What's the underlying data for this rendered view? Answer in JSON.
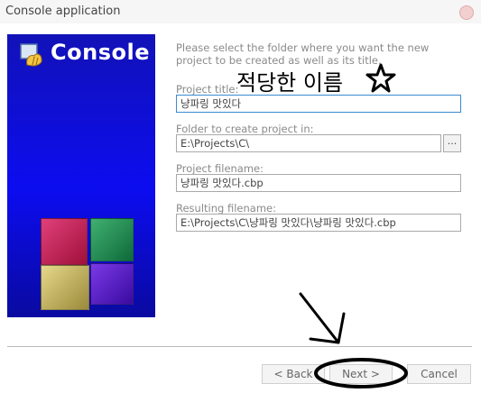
{
  "window": {
    "title": "Console application"
  },
  "banner": {
    "title": "Console"
  },
  "instruction": "Please select the folder where you want the new project to be created as well as its title.",
  "overlay": {
    "text": "적당한 이름"
  },
  "fields": {
    "project_title_label": "Project title:",
    "project_title_value": "냥파링 맛있다",
    "folder_label": "Folder to create project in:",
    "folder_value": "E:\\Projects\\C\\",
    "browse_label": "...",
    "filename_label": "Project filename:",
    "filename_value": "냥파링 맛있다.cbp",
    "resulting_label": "Resulting filename:",
    "resulting_value": "E:\\Projects\\C\\냥파링 맛있다\\냥파링 맛있다.cbp"
  },
  "buttons": {
    "back": "< Back",
    "next": "Next >",
    "cancel": "Cancel"
  },
  "icons": {
    "logo": "code-blocks-logo-icon",
    "close": "close-icon",
    "star": "star-icon",
    "arrow": "annotation-arrow-icon"
  },
  "colors": {
    "banner": "#0c0cf0",
    "active_border": "#3c8ad0",
    "annotation": "#000000"
  }
}
